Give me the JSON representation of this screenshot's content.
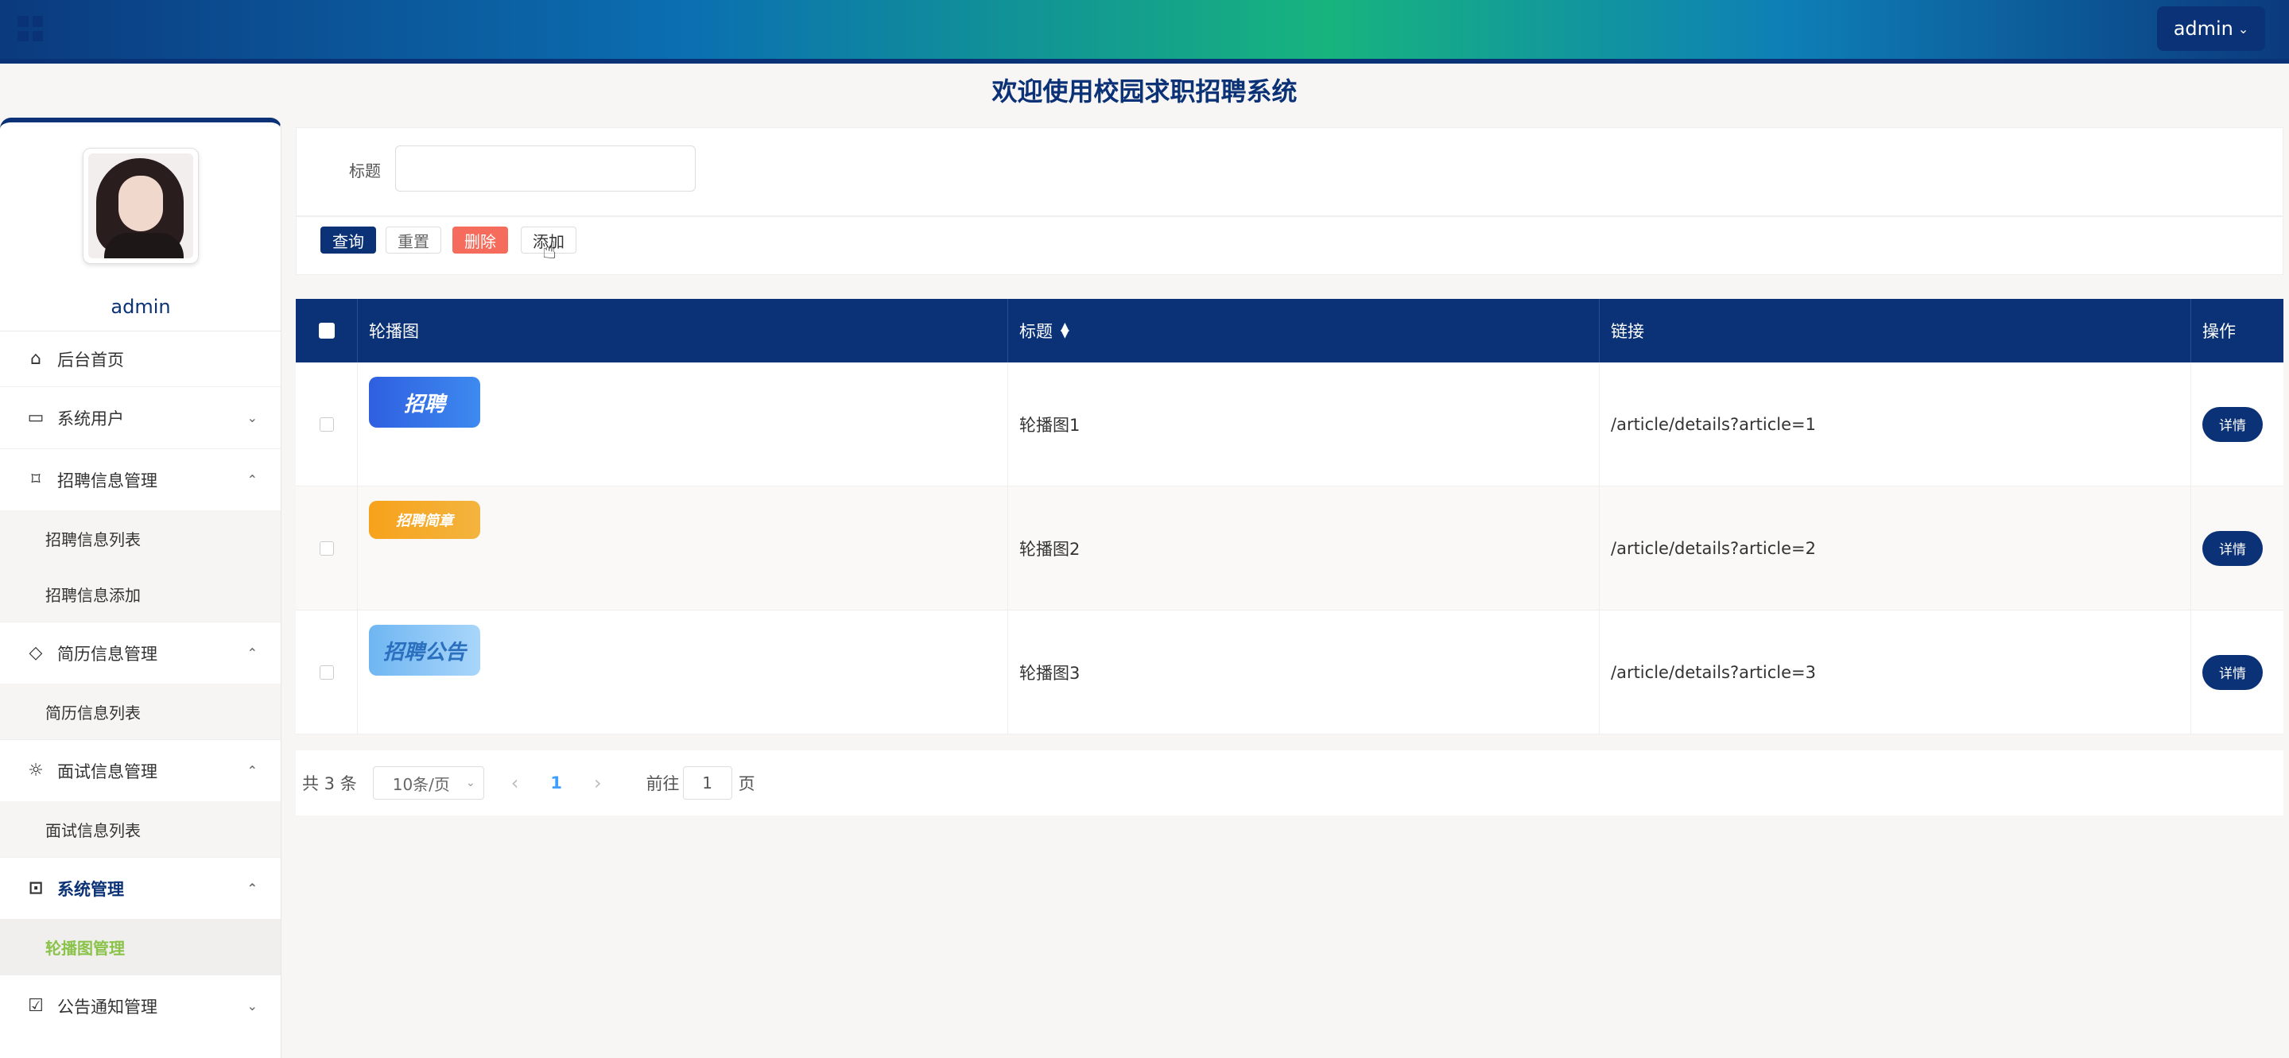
{
  "header": {
    "user_label": "admin"
  },
  "welcome": "欢迎使用校园求职招聘系统",
  "sidebar": {
    "username": "admin",
    "items": [
      {
        "label": "后台首页",
        "icon": "home-icon"
      },
      {
        "label": "系统用户",
        "icon": "laptop-icon"
      },
      {
        "label": "招聘信息管理",
        "icon": "bookmark-icon",
        "children": [
          "招聘信息列表",
          "招聘信息添加"
        ]
      },
      {
        "label": "简历信息管理",
        "icon": "tag-icon",
        "children": [
          "简历信息列表"
        ]
      },
      {
        "label": "面试信息管理",
        "icon": "sun-icon",
        "children": [
          "面试信息列表"
        ]
      },
      {
        "label": "系统管理",
        "icon": "inbox-icon",
        "children": [
          "轮播图管理"
        ]
      },
      {
        "label": "公告通知管理",
        "icon": "clipboard-icon"
      }
    ]
  },
  "search": {
    "label": "标题",
    "value": "",
    "buttons": {
      "query": "查询",
      "reset": "重置",
      "delete": "删除",
      "add": "添加"
    }
  },
  "table": {
    "columns": [
      "轮播图",
      "标题",
      "链接",
      "操作"
    ],
    "rows": [
      {
        "thumb_text": "招聘",
        "title": "轮播图1",
        "link": "/article/details?article=1",
        "action": "详情"
      },
      {
        "thumb_text": "招聘简章",
        "title": "轮播图2",
        "link": "/article/details?article=2",
        "action": "详情"
      },
      {
        "thumb_text": "招聘公告",
        "title": "轮播图3",
        "link": "/article/details?article=3",
        "action": "详情"
      }
    ]
  },
  "pagination": {
    "total": "共 3 条",
    "page_size": "10条/页",
    "current": "1",
    "goto_label": "前往",
    "goto_value": "1",
    "page_unit": "页"
  },
  "colors": {
    "primary": "#0b3276",
    "danger": "#f56c5c",
    "active_sub": "#8bc34a"
  }
}
